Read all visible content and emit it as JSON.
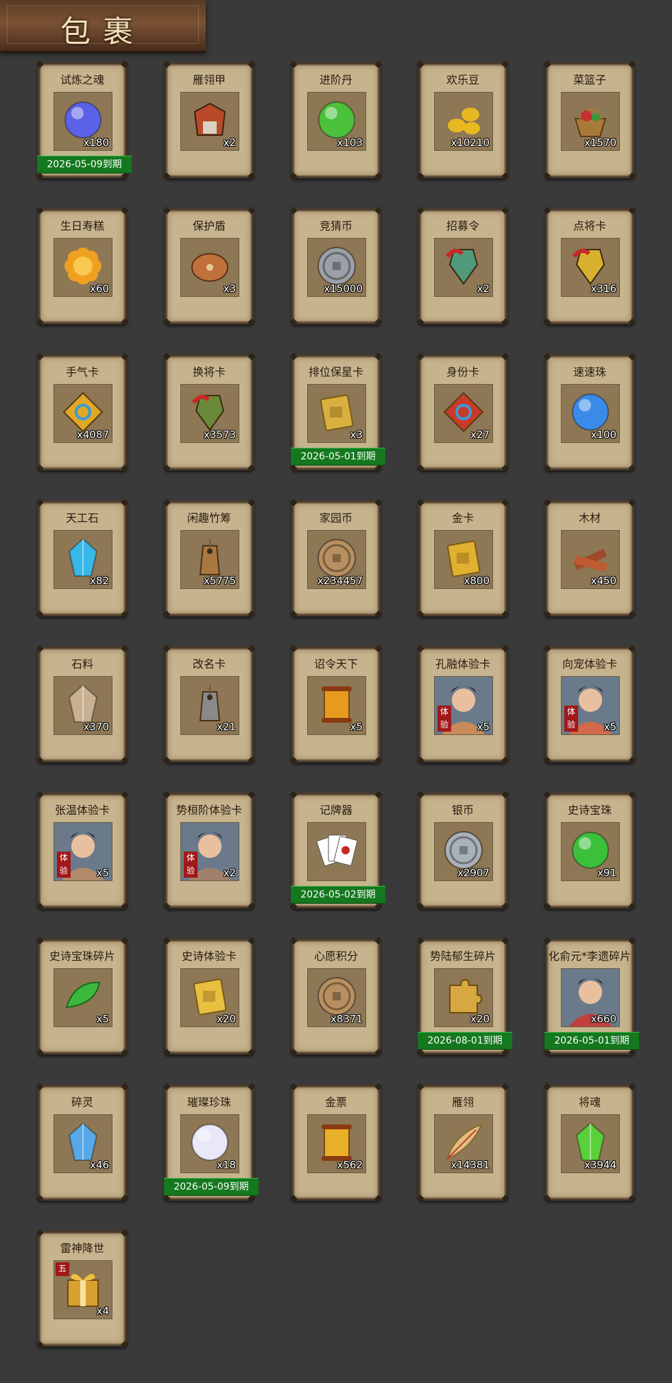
{
  "title": "包裹",
  "items": [
    {
      "name": "试炼之魂",
      "count": "x180",
      "expire": "2026-05-09到期",
      "icon": "blue-orb-icon",
      "color": "#5b62e8",
      "shape": "circle"
    },
    {
      "name": "雁翎甲",
      "count": "x2",
      "expire": "",
      "icon": "armor-icon",
      "color": "#b84a2a",
      "shape": "armor"
    },
    {
      "name": "进阶丹",
      "count": "x103",
      "expire": "",
      "icon": "green-pill-icon",
      "color": "#4cc23c",
      "shape": "circle"
    },
    {
      "name": "欢乐豆",
      "count": "x10210",
      "expire": "",
      "icon": "gold-beans-icon",
      "color": "#e8b820",
      "shape": "beans"
    },
    {
      "name": "菜篮子",
      "count": "x1570",
      "expire": "",
      "icon": "basket-icon",
      "color": "#c83030",
      "shape": "basket"
    },
    {
      "name": "生日寿糕",
      "count": "x60",
      "expire": "",
      "icon": "mooncake-icon",
      "color": "#f0a020",
      "shape": "flower"
    },
    {
      "name": "保护盾",
      "count": "x3",
      "expire": "",
      "icon": "shield-icon",
      "color": "#c0703a",
      "shape": "ellipse"
    },
    {
      "name": "竞猜币",
      "count": "x15000",
      "expire": "",
      "icon": "silver-coin-icon",
      "color": "#9aa0a8",
      "shape": "coin"
    },
    {
      "name": "招募令",
      "count": "x2",
      "expire": "",
      "icon": "jade-token-icon",
      "color": "#4e9a7a",
      "shape": "token"
    },
    {
      "name": "点将卡",
      "count": "x316",
      "expire": "",
      "icon": "gold-token-icon",
      "color": "#d8b030",
      "shape": "token"
    },
    {
      "name": "手气卡",
      "count": "x4087",
      "expire": "",
      "icon": "luck-card-icon",
      "color": "#e0a828",
      "shape": "diamond"
    },
    {
      "name": "换将卡",
      "count": "x3573",
      "expire": "",
      "icon": "swap-card-icon",
      "color": "#6a8a3a",
      "shape": "token"
    },
    {
      "name": "排位保星卡",
      "count": "x3",
      "expire": "2026-05-01到期",
      "icon": "star-card-icon",
      "color": "#d8b040",
      "shape": "card"
    },
    {
      "name": "身份卡",
      "count": "x27",
      "expire": "",
      "icon": "mask-card-icon",
      "color": "#c83a2a",
      "shape": "diamond"
    },
    {
      "name": "速速珠",
      "count": "x100",
      "expire": "",
      "icon": "blue-pearl-icon",
      "color": "#3a8ae8",
      "shape": "circle"
    },
    {
      "name": "天工石",
      "count": "x82",
      "expire": "",
      "icon": "crystal-icon",
      "color": "#38b8e8",
      "shape": "crystal"
    },
    {
      "name": "闲趣竹筹",
      "count": "x5775",
      "expire": "",
      "icon": "bamboo-tag-icon",
      "color": "#a87840",
      "shape": "tag"
    },
    {
      "name": "家园币",
      "count": "x234457",
      "expire": "",
      "icon": "bronze-coin-icon",
      "color": "#b89060",
      "shape": "coin"
    },
    {
      "name": "金卡",
      "count": "x800",
      "expire": "",
      "icon": "gold-card-icon",
      "color": "#e0b030",
      "shape": "card"
    },
    {
      "name": "木材",
      "count": "x450",
      "expire": "",
      "icon": "wood-icon",
      "color": "#a04a2a",
      "shape": "wood"
    },
    {
      "name": "石料",
      "count": "x370",
      "expire": "",
      "icon": "stone-icon",
      "color": "#c8b090",
      "shape": "crystal"
    },
    {
      "name": "改名卡",
      "count": "x21",
      "expire": "",
      "icon": "rename-tag-icon",
      "color": "#8a8a8a",
      "shape": "tag"
    },
    {
      "name": "诏令天下",
      "count": "x5",
      "expire": "",
      "icon": "scroll-icon",
      "color": "#e89a20",
      "shape": "scroll"
    },
    {
      "name": "孔融体验卡",
      "count": "x5",
      "expire": "",
      "icon": "hero-portrait-icon",
      "color": "#c88a5a",
      "shape": "portrait",
      "trial": "体验"
    },
    {
      "name": "向宠体验卡",
      "count": "x5",
      "expire": "",
      "icon": "hero-portrait-icon",
      "color": "#d06a4a",
      "shape": "portrait",
      "trial": "体验"
    },
    {
      "name": "张温体验卡",
      "count": "x5",
      "expire": "",
      "icon": "hero-portrait-icon",
      "color": "#b08a6a",
      "shape": "portrait",
      "trial": "体验"
    },
    {
      "name": "势桓阶体验卡",
      "count": "x2",
      "expire": "",
      "icon": "hero-portrait-icon",
      "color": "#a0806a",
      "shape": "portrait",
      "trial": "体验"
    },
    {
      "name": "记牌器",
      "count": "",
      "expire": "2026-05-02到期",
      "icon": "playing-cards-icon",
      "color": "#f0f0f0",
      "shape": "cards"
    },
    {
      "name": "银币",
      "count": "x2907",
      "expire": "",
      "icon": "silver-coins-icon",
      "color": "#a8b0b8",
      "shape": "coin"
    },
    {
      "name": "史诗宝珠",
      "count": "x91",
      "expire": "",
      "icon": "green-orb-icon",
      "color": "#3cc03c",
      "shape": "circle"
    },
    {
      "name": "史诗宝珠碎片",
      "count": "x5",
      "expire": "",
      "icon": "green-leaf-icon",
      "color": "#3cb83c",
      "shape": "leaf"
    },
    {
      "name": "史诗体验卡",
      "count": "x20",
      "expire": "",
      "icon": "gold-card-icon",
      "color": "#e8c040",
      "shape": "card"
    },
    {
      "name": "心愿积分",
      "count": "x8371",
      "expire": "",
      "icon": "heart-coin-icon",
      "color": "#b89060",
      "shape": "coin"
    },
    {
      "name": "势陆郁生碎片",
      "count": "x20",
      "expire": "2026-08-01到期",
      "icon": "puzzle-piece-icon",
      "color": "#d8a840",
      "shape": "puzzle"
    },
    {
      "name": "化俞元*李遗碎片",
      "count": "x660",
      "expire": "2026-05-01到期",
      "icon": "hero-portrait-icon",
      "color": "#c04040",
      "shape": "portrait"
    },
    {
      "name": "碎灵",
      "count": "x46",
      "expire": "",
      "icon": "soul-crystal-icon",
      "color": "#58a8e8",
      "shape": "crystal"
    },
    {
      "name": "璀璨珍珠",
      "count": "x18",
      "expire": "2026-05-09到期",
      "icon": "pearl-icon",
      "color": "#e8e8f8",
      "shape": "circle"
    },
    {
      "name": "金票",
      "count": "x562",
      "expire": "",
      "icon": "gold-ticket-icon",
      "color": "#e8b028",
      "shape": "scroll"
    },
    {
      "name": "雁翎",
      "count": "x14381",
      "expire": "",
      "icon": "feather-icon",
      "color": "#e0c080",
      "shape": "feather"
    },
    {
      "name": "将魂",
      "count": "x3944",
      "expire": "",
      "icon": "green-gem-icon",
      "color": "#5ad03a",
      "shape": "crystal"
    },
    {
      "name": "雷神降世",
      "count": "x4",
      "expire": "",
      "icon": "gift-box-icon",
      "color": "#d8a030",
      "shape": "gift",
      "badge": "五"
    }
  ]
}
